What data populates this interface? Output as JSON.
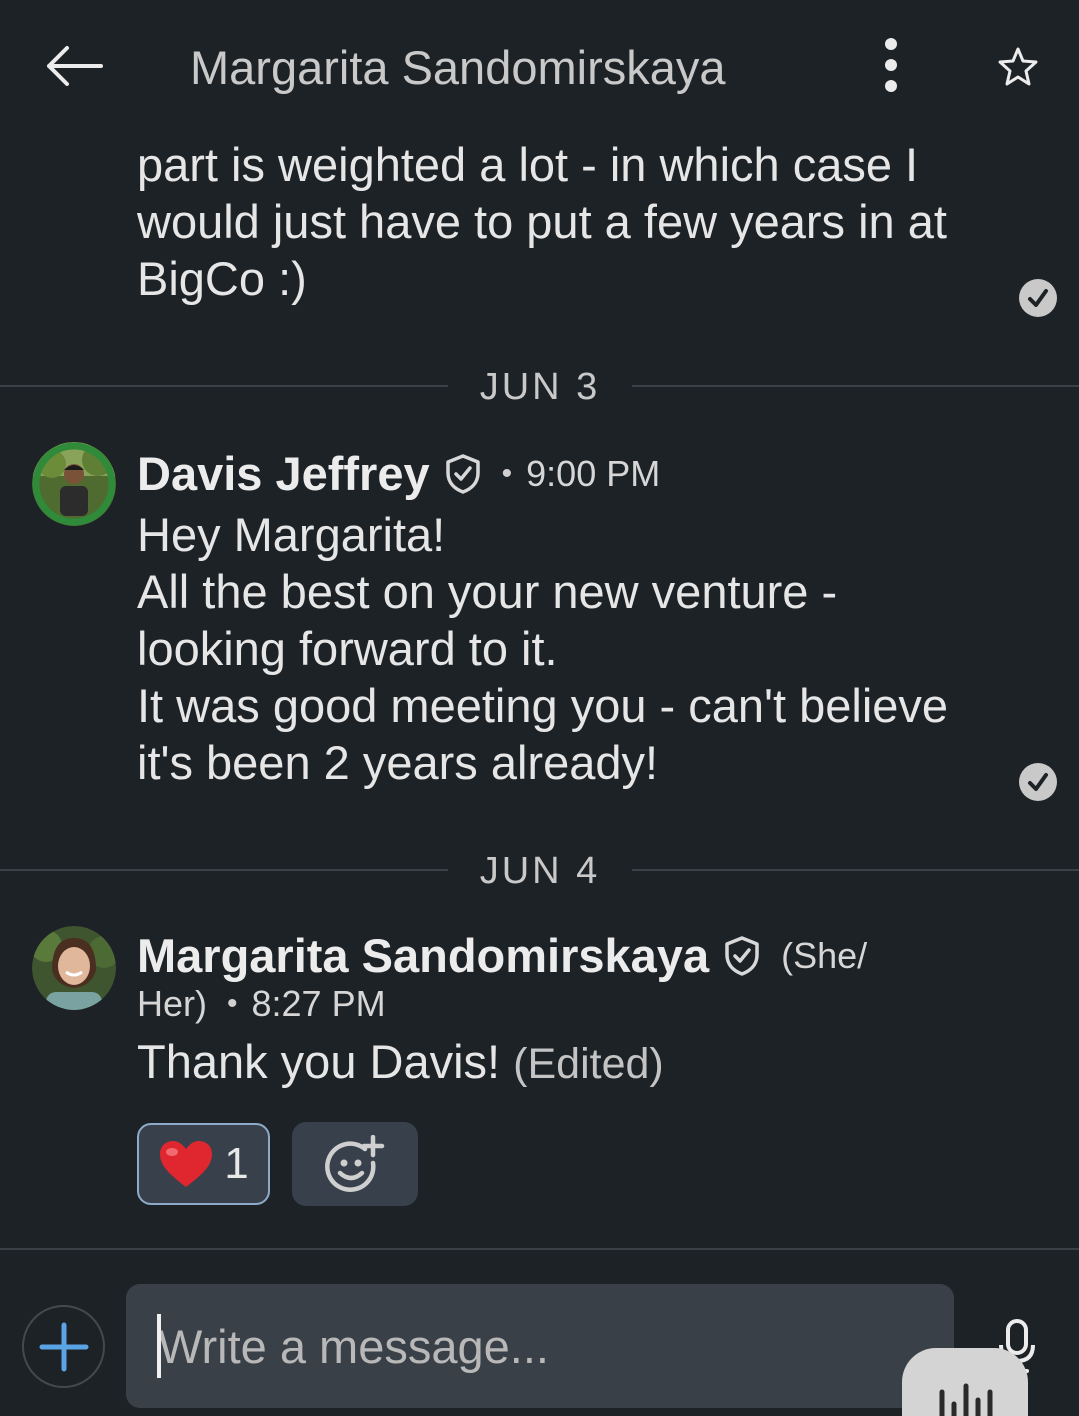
{
  "header": {
    "title": "Margarita Sandomirskaya",
    "back_icon": "arrow-left-icon",
    "more_icon": "vertical-dots-icon",
    "star_icon": "star-outline-icon"
  },
  "messages": {
    "previous": {
      "lines": [
        "part is weighted a lot - in which case I",
        "would just have to put a few years in at",
        "BigCo :)"
      ]
    },
    "date1": "JUN 3",
    "davis": {
      "name": "Davis Jeffrey",
      "bullet": "•",
      "time": "9:00 PM",
      "lines": [
        "Hey Margarita!",
        "All the best on your new venture -",
        "looking forward to it.",
        "It was good meeting you - can't believe",
        "it's been 2 years already!"
      ]
    },
    "date2": "JUN 4",
    "margarita": {
      "name": "Margarita Sandomirskaya",
      "pronoun_a": "(She/",
      "pronoun_b": "Her)",
      "bullet": "•",
      "time": "8:27 PM",
      "text": "Thank you Davis!",
      "edited": "(Edited)",
      "reaction_emoji": "❤️",
      "reaction_count": "1"
    }
  },
  "composer": {
    "placeholder": "Write a message...",
    "plus_icon": "plus-icon",
    "mic_icon": "microphone-icon"
  },
  "colors": {
    "background": "#1d2226",
    "accent": "#5aa4e6",
    "reaction_border": "#8faac8"
  }
}
